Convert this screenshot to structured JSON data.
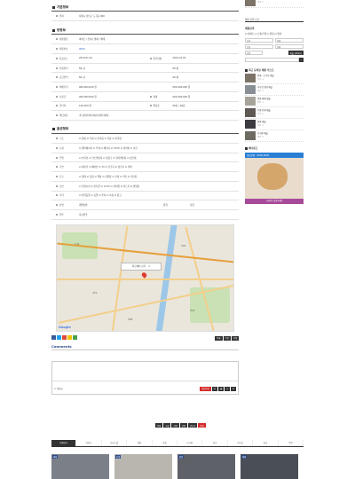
{
  "sections": {
    "basic": {
      "title": "기본정보",
      "rows": [
        {
          "label": "위치",
          "value": "서울시 강남구 도곡동 000"
        }
      ]
    },
    "property": {
      "title": "방정보",
      "rows": [
        {
          "l1": "매물종류",
          "v1": "아파트 / 전세 / 월세 / 매매",
          "l2": "",
          "v2": ""
        },
        {
          "l1": "매물번호",
          "v1": "0000",
          "l2": "",
          "v2": "",
          "blue": true
        },
        {
          "l1": "준공년도",
          "v1": "2010-01-01",
          "l2": "입주날짜",
          "v2": "2023-01-01"
        },
        {
          "l1": "전용면적",
          "v1": "84 ㎡",
          "l2": "",
          "v2": "00 평"
        },
        {
          "l1": "공급면적",
          "v1": "84 ㎡",
          "l2": "",
          "v2": "00 평"
        },
        {
          "l1": "매매가격",
          "v1": "000,000,000 원",
          "l2": "",
          "v2": "000,000,000 원"
        },
        {
          "l1": "보증금",
          "v1": "000,000,000 원",
          "l2": "월세",
          "v2": "000,000,000 원"
        },
        {
          "l1": "관리비",
          "v1": "100,000 원",
          "l2": "해당층",
          "v2": "00층 / 00층"
        },
        {
          "l1": "해당이유",
          "v1": "가나다라마바사아자차카타파하",
          "l2": "",
          "v2": ""
        }
      ]
    },
    "options": {
      "title": "옵션정보",
      "rows": [
        {
          "label": "구조",
          "value": "☑ 원룸 ☑ 투룸 ☑ 쓰리룸 ☑ 복층 ☑ 분리형"
        },
        {
          "label": "시설",
          "value": "☑ 엘리베이터 ☑ 주차 ☑ 베란다 ☑ CCTV ☑ 경비실 ☑ 보안"
        },
        {
          "label": "주방",
          "value": "☑ 인덕션 ☑ 가스레인지 ☑ 냉장고 ☑ 전자레인지 ☑ 싱크대"
        },
        {
          "label": "가전",
          "value": "☑ 세탁기 ☑ 에어컨 ☑ TV ☑ 건조기 ☑ 정수기 ☑ 비데"
        },
        {
          "label": "가구",
          "value": "☑ 침대 ☑ 옷장 ☑ 책상 ☑ 신발장 ☑ 소파 ☑ 식탁 ☑ 수납장"
        },
        {
          "label": "보안",
          "value": "☑ 현관보안 ☑ 인터폰 ☑ CCTV ☑ 경비원 ☑ 카드키 ☑ 방범창"
        },
        {
          "label": "기타",
          "value": "☑ 반려동물 ☑ 흡연 ☑ 주차 ☑ 옥상 ☑ 창고"
        },
        {
          "label": "난방",
          "value": "개별난방",
          "l2": "방향",
          "v2": "남향"
        },
        {
          "label": "입주",
          "value": "즉시입주"
        }
      ]
    }
  },
  "map": {
    "search_label": "지도에서 보기",
    "google": "Google",
    "labels": [
      "도곡동",
      "역삼동",
      "개포동",
      "대치동",
      "양재동"
    ]
  },
  "share": {
    "buttons": [
      "목록",
      "수정",
      "삭제"
    ]
  },
  "comments": {
    "title": "Comments",
    "secret": "비밀글",
    "submit": "댓글등록"
  },
  "actions": [
    "목록",
    "수정",
    "삭제",
    "답변",
    "글쓰기",
    "인쇄"
  ],
  "tabs": [
    "전체보기",
    "아파트",
    "오피스텔",
    "원룸",
    "투룸",
    "쓰리룸",
    "상가",
    "사무실",
    "빌라",
    "주택"
  ],
  "thumbs": [
    {
      "tag": "매매"
    },
    {
      "tag": "전세"
    },
    {
      "tag": "월세"
    },
    {
      "tag": "매매"
    }
  ],
  "sidebar": {
    "top_line": "매물 검색 조건",
    "filters_title": "매물검색",
    "chk": "☑ 아파트 ☑ 오피스텔 ☑ 원룸 ☑ 빌라",
    "sel1": [
      "지역",
      "전체"
    ],
    "sel2": [
      "종류",
      "전체"
    ],
    "sel3": "검색",
    "search_btn": "매물 검색하기",
    "recent_title": "최근 등록된 매물 리스트",
    "items": [
      {
        "title": "원룸 - 도곡동 매물",
        "meta": "전세 · 0"
      },
      {
        "title": "사무실 임대 매물",
        "meta": "월세 · 0"
      },
      {
        "title": "원룸 매매 매물",
        "meta": "매매 · 0"
      },
      {
        "title": "투룸 전세 매물",
        "meta": "전세 · 0"
      },
      {
        "title": "원룸 매물",
        "meta": "월세 · 0"
      },
      {
        "title": "쓰리룸 매물",
        "meta": "매매 · 0"
      }
    ],
    "ad_title": "배너광고",
    "ad_phone": "상담문의 : 0000-0000",
    "ad_footer": "지금바로 상담하세요"
  },
  "colors": {
    "accent": "#2a4a8a",
    "red": "#d42a2a",
    "dark": "#333333"
  }
}
